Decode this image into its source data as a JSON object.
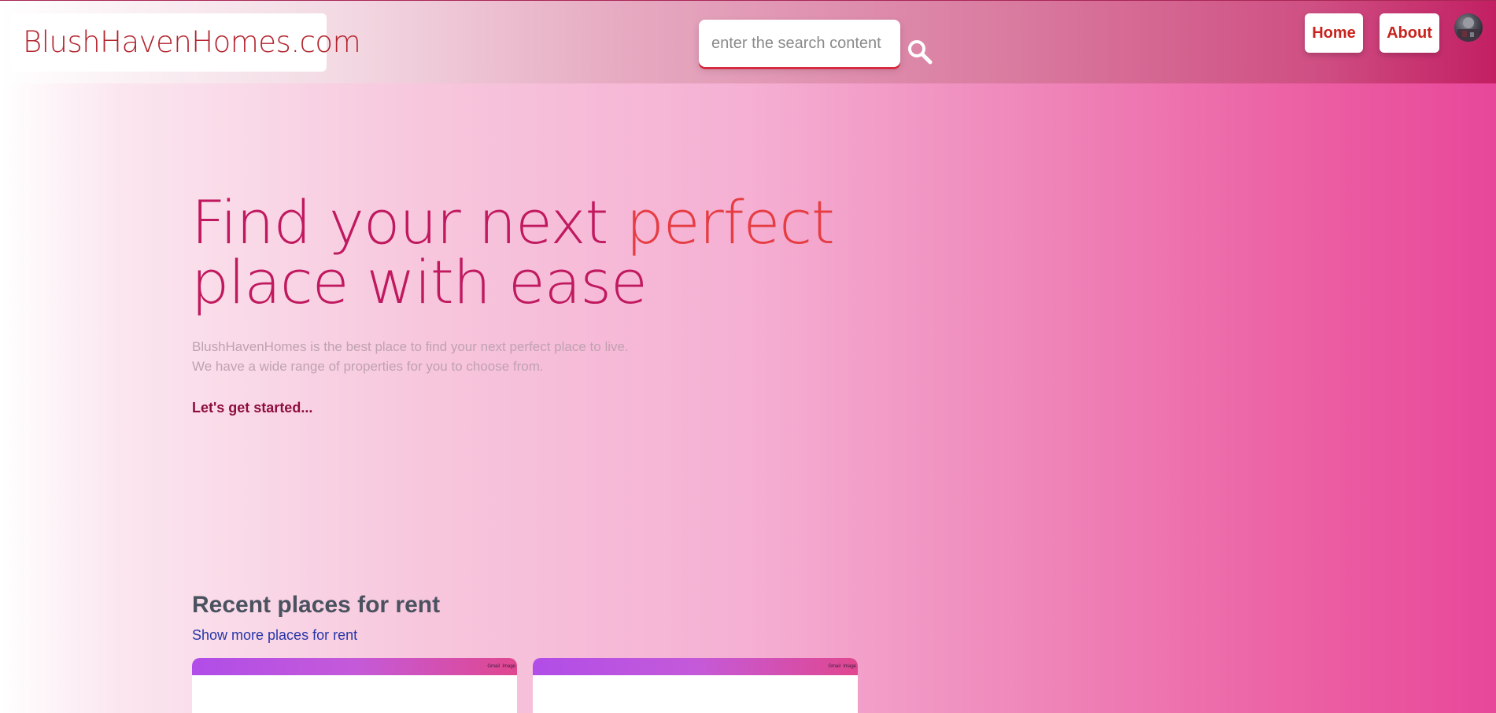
{
  "header": {
    "brand": "BlushHavenHomes.com",
    "search": {
      "placeholder": "enter the search content",
      "value": ""
    },
    "nav": {
      "home": "Home",
      "about": "About"
    }
  },
  "hero": {
    "title_part1": "Find your next ",
    "title_highlight": "perfect",
    "title_part2": "place with ease",
    "description_line1": "BlushHavenHomes is the best place to find your next perfect place to live.",
    "description_line2": "We have a wide range of properties for you to choose from.",
    "cta": "Let's get started..."
  },
  "recent": {
    "title": "Recent places for rent",
    "more_link": "Show more places for rent",
    "cards": [
      {
        "mini_labels": [
          "Gmail",
          "Image"
        ]
      },
      {
        "mini_labels": [
          "Gmail",
          "Image"
        ]
      }
    ]
  },
  "colors": {
    "brand_red": "#b3232d",
    "accent_pink": "#c0195f",
    "highlight": "#e63d43",
    "link_blue": "#2636a8"
  },
  "icons": {
    "search": "search-icon",
    "avatar": "avatar"
  }
}
